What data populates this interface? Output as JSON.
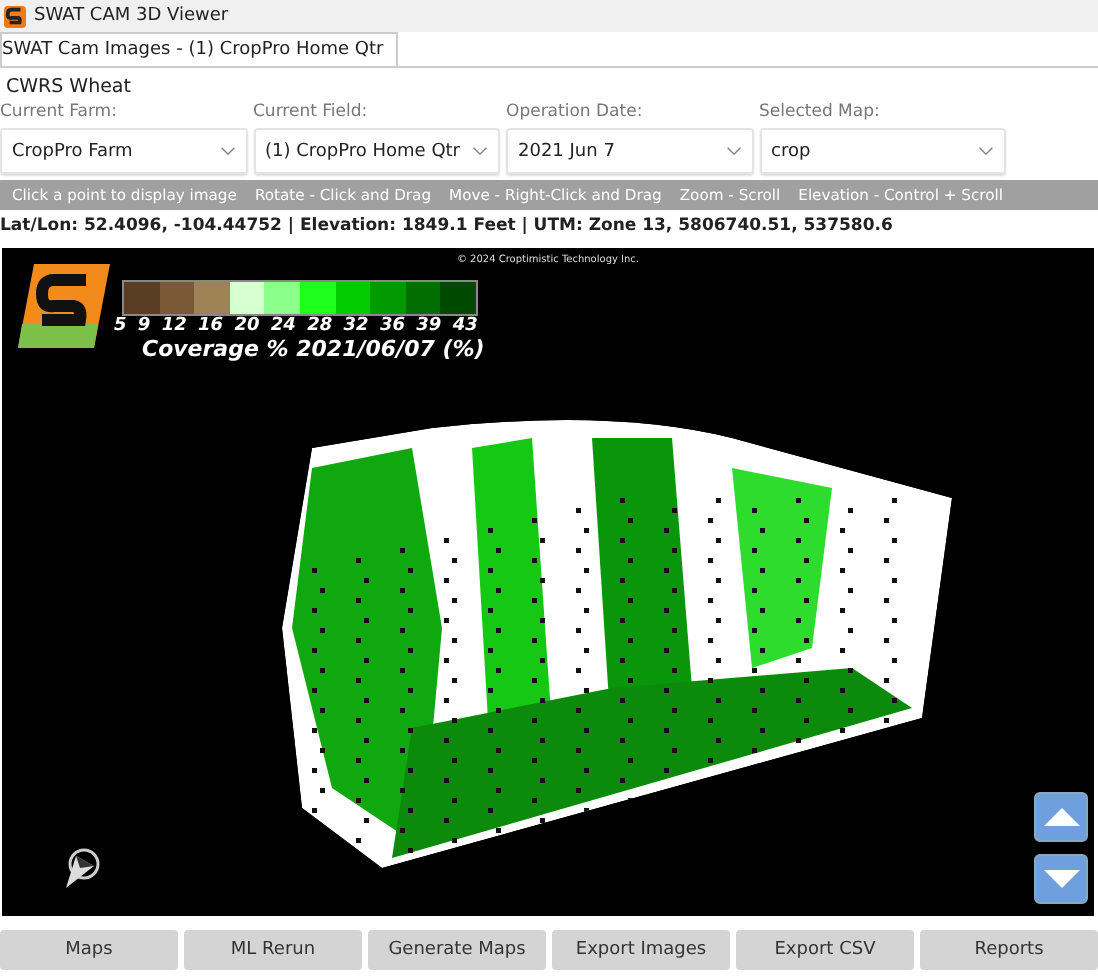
{
  "window": {
    "title": "SWAT CAM 3D Viewer"
  },
  "tabs": [
    {
      "label": "SWAT Cam Images - (1) CropPro Home Qtr",
      "selected": true
    }
  ],
  "crop": "CWRS Wheat",
  "selectors": [
    {
      "label": "Current Farm:",
      "value": "CropPro Farm"
    },
    {
      "label": "Current Field:",
      "value": "(1) CropPro Home Qtr"
    },
    {
      "label": "Operation Date:",
      "value": "2021 Jun 7"
    },
    {
      "label": "Selected Map:",
      "value": "crop"
    }
  ],
  "hints": [
    "Click a point to display image",
    "Rotate - Click and Drag",
    "Move - Right-Click and Drag",
    "Zoom - Scroll",
    "Elevation - Control + Scroll"
  ],
  "position_info": "Lat/Lon: 52.4096, -104.44752 | Elevation: 1849.1 Feet | UTM: Zone 13, 5806740.51, 537580.6",
  "viewer": {
    "copyright": "© 2024 Croptimistic Technology Inc.",
    "legend": {
      "title": "Coverage % 2021/06/07 (%)",
      "ticks": [
        "5",
        "9",
        "12",
        "16",
        "20",
        "24",
        "28",
        "32",
        "36",
        "39",
        "43"
      ],
      "swatches": [
        {
          "color": "#5a3d22"
        },
        {
          "color": "#7a5a36"
        },
        {
          "color": "#a08257"
        },
        {
          "color": "#d6ffd0"
        },
        {
          "color": "#8cff8a"
        },
        {
          "color": "#1eff1e"
        },
        {
          "color": "#00cc00"
        },
        {
          "color": "#009a00"
        },
        {
          "color": "#006e00"
        },
        {
          "color": "#004a00"
        }
      ]
    }
  },
  "buttons": [
    "Maps",
    "ML Rerun",
    "Generate Maps",
    "Export Images",
    "Export CSV",
    "Reports"
  ]
}
